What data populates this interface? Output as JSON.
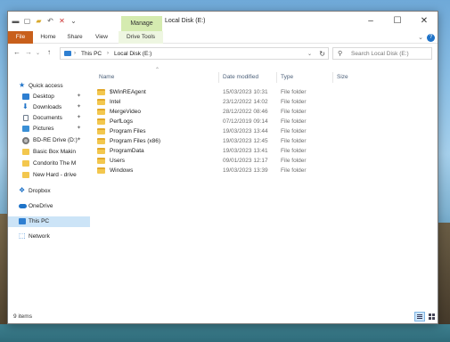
{
  "window": {
    "title": "Local Disk (E:)",
    "manage_tab": "Manage"
  },
  "controls": {
    "minimize": "–",
    "maximize": "☐",
    "close": "✕"
  },
  "ribbon": {
    "file": "File",
    "home": "Home",
    "share": "Share",
    "view": "View",
    "drive_tools": "Drive Tools",
    "expand": "⌄",
    "help": "?"
  },
  "nav": {
    "back": "←",
    "forward": "→",
    "recent": "⌄",
    "up": "↑"
  },
  "address": {
    "segments": [
      "This PC",
      "Local Disk (E:)"
    ],
    "chevron": "›"
  },
  "search": {
    "placeholder": "Search Local Disk (E:)"
  },
  "sidebar": {
    "items": [
      {
        "label": "Quick access",
        "icon": "star-icon",
        "color": "#1f73c8"
      },
      {
        "label": "Desktop",
        "icon": "desktop-icon",
        "color": "#2e7fd1",
        "pinned": true
      },
      {
        "label": "Downloads",
        "icon": "download-icon",
        "color": "#1f73c8",
        "pinned": true
      },
      {
        "label": "Documents",
        "icon": "document-icon",
        "color": "#6d7b8c",
        "pinned": true
      },
      {
        "label": "Pictures",
        "icon": "pictures-icon",
        "color": "#3a8fd6",
        "pinned": true
      },
      {
        "label": "BD-RE Drive (D:)",
        "icon": "disc-icon",
        "color": "#6d6d6d",
        "pinned": true
      },
      {
        "label": "Basic Box Makin",
        "icon": "folder-icon",
        "color": "#f3c74e"
      },
      {
        "label": "Condorito The M",
        "icon": "folder-icon",
        "color": "#f3c74e"
      },
      {
        "label": "New Hard - drive",
        "icon": "folder-icon",
        "color": "#f3c74e"
      },
      {
        "label": "Dropbox",
        "icon": "dropbox-icon",
        "color": "#1f73c8"
      },
      {
        "label": "OneDrive",
        "icon": "onedrive-icon",
        "color": "#1f73c8"
      },
      {
        "label": "This PC",
        "icon": "computer-icon",
        "color": "#2e7fd1",
        "selected": true
      },
      {
        "label": "Network",
        "icon": "network-icon",
        "color": "#2e7fd1"
      }
    ]
  },
  "columns": {
    "name": "Name",
    "date": "Date modified",
    "type": "Type",
    "size": "Size"
  },
  "files": [
    {
      "name": "$WinREAgent",
      "date": "15/03/2023 10:31",
      "type": "File folder"
    },
    {
      "name": "Intel",
      "date": "23/12/2022 14:02",
      "type": "File folder"
    },
    {
      "name": "MergeVideo",
      "date": "28/12/2022 08:46",
      "type": "File folder"
    },
    {
      "name": "PerfLogs",
      "date": "07/12/2019 09:14",
      "type": "File folder"
    },
    {
      "name": "Program Files",
      "date": "19/03/2023 13:44",
      "type": "File folder"
    },
    {
      "name": "Program Files (x86)",
      "date": "19/03/2023 12:45",
      "type": "File folder"
    },
    {
      "name": "ProgramData",
      "date": "19/03/2023 13:41",
      "type": "File folder"
    },
    {
      "name": "Users",
      "date": "09/01/2023 12:17",
      "type": "File folder"
    },
    {
      "name": "Windows",
      "date": "19/03/2023 13:39",
      "type": "File folder"
    }
  ],
  "status": {
    "count": "9 items"
  }
}
